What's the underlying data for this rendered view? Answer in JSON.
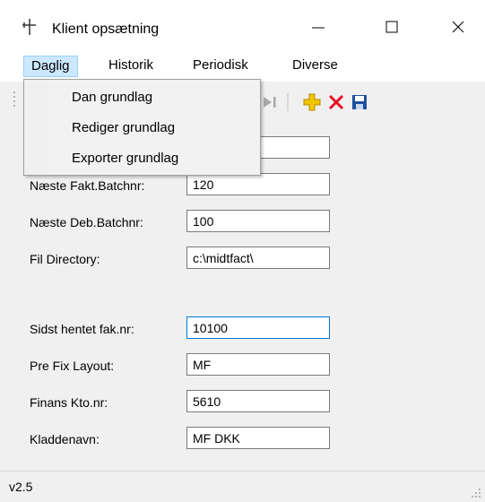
{
  "window": {
    "title": "Klient opsætning",
    "icon": "pin-icon",
    "controls": {
      "minimize": "minimize-icon",
      "maximize": "maximize-icon",
      "close": "close-icon"
    }
  },
  "menu": {
    "items": [
      {
        "label": "Daglig"
      },
      {
        "label": "Historik"
      },
      {
        "label": "Periodisk"
      },
      {
        "label": "Diverse"
      }
    ],
    "open_dropdown": {
      "items": [
        {
          "label": "Dan grundlag"
        },
        {
          "label": "Rediger grundlag"
        },
        {
          "label": "Exporter grundlag"
        }
      ]
    }
  },
  "toolbar": {
    "icons": [
      "last-record-icon",
      "add-icon",
      "delete-icon",
      "save-icon"
    ]
  },
  "form": {
    "fields": [
      {
        "label": "",
        "value": ""
      },
      {
        "label": "Næste Fakt.Batchnr:",
        "value": "120"
      },
      {
        "label": "Næste Deb.Batchnr:",
        "value": "100"
      },
      {
        "label": "Fil Directory:",
        "value": "c:\\midtfact\\"
      },
      {
        "label": "Sidst hentet fak.nr:",
        "value": "10100"
      },
      {
        "label": "Pre Fix Layout:",
        "value": "MF"
      },
      {
        "label": "Finans Kto.nr:",
        "value": "5610"
      },
      {
        "label": "Kladdenavn:",
        "value": "MF DKK"
      }
    ]
  },
  "status": {
    "version": "v2.5"
  },
  "colors": {
    "menu_active_bg": "#cce8ff",
    "focus_border": "#0078d7",
    "delete_red": "#e81123",
    "add_yellow": "#f2c500",
    "save_blue": "#1f4fa0"
  }
}
